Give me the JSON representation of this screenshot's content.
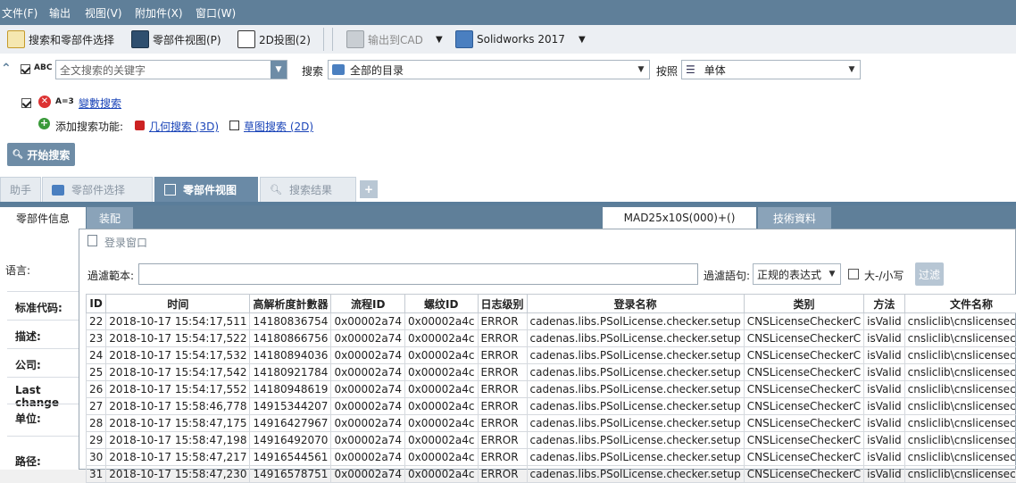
{
  "menu": [
    "文件(F)",
    "输出",
    "视图(V)",
    "附加件(X)",
    "窗口(W)"
  ],
  "toolbar": {
    "search_parts": "搜索和零部件选择",
    "part_view": "零部件视图(P)",
    "drawing_2d": "2D投图(2)",
    "export_cad": "输出到CAD",
    "cad_system": "Solidworks 2017"
  },
  "search": {
    "abc": "ABC",
    "keyword_placeholder": "全文搜索的关键字",
    "search_label": "搜索",
    "catalog": "全部的目录",
    "by_label": "按照",
    "unit": "单体"
  },
  "param": {
    "a3": "A=3",
    "param_search": "變數搜索",
    "add_label": "添加搜索功能:",
    "geo_search": "几何搜索 (3D)",
    "sketch_search": "草图搜索 (2D)",
    "start": "开始搜索"
  },
  "tabs": {
    "assist": "助手",
    "part_select": "零部件选择",
    "part_view": "零部件视图",
    "results": "搜索结果",
    "add": "+"
  },
  "subtabs": {
    "part_info": "零部件信息",
    "assembly": "装配",
    "part_name": "MAD25x10S(000)+()",
    "tech": "技術資料"
  },
  "left": {
    "language": "语言:",
    "std_code": "标准代码:",
    "desc": "描述:",
    "company": "公司:",
    "last_change": "Last change",
    "unit": "单位:",
    "path": "路径:"
  },
  "log": {
    "title": "登录窗口",
    "filter_label": "過濾範本:",
    "filter_value": "",
    "expr_label": "過濾語句:",
    "expr_value": "正规的表达式",
    "case_label": "大-/小写",
    "filter_btn": "过滤",
    "columns": [
      "ID",
      "时间",
      "高解析度計數器",
      "流程ID",
      "螺纹ID",
      "日志级别",
      "登录名称",
      "类别",
      "方法",
      "文件名称"
    ],
    "rows": [
      [
        "22",
        "2018-10-17 15:54:17,511",
        "14180836754",
        "0x00002a74",
        "0x00002a4c",
        "ERROR",
        "cadenas.libs.PSolLicense.checker.setup",
        "CNSLicenseCheckerC",
        "isValid",
        "cnsliclib\\cnslicensechec"
      ],
      [
        "23",
        "2018-10-17 15:54:17,522",
        "14180866756",
        "0x00002a74",
        "0x00002a4c",
        "ERROR",
        "cadenas.libs.PSolLicense.checker.setup",
        "CNSLicenseCheckerC",
        "isValid",
        "cnsliclib\\cnslicensechec"
      ],
      [
        "24",
        "2018-10-17 15:54:17,532",
        "14180894036",
        "0x00002a74",
        "0x00002a4c",
        "ERROR",
        "cadenas.libs.PSolLicense.checker.setup",
        "CNSLicenseCheckerC",
        "isValid",
        "cnsliclib\\cnslicensechec"
      ],
      [
        "25",
        "2018-10-17 15:54:17,542",
        "14180921784",
        "0x00002a74",
        "0x00002a4c",
        "ERROR",
        "cadenas.libs.PSolLicense.checker.setup",
        "CNSLicenseCheckerC",
        "isValid",
        "cnsliclib\\cnslicensechec"
      ],
      [
        "26",
        "2018-10-17 15:54:17,552",
        "14180948619",
        "0x00002a74",
        "0x00002a4c",
        "ERROR",
        "cadenas.libs.PSolLicense.checker.setup",
        "CNSLicenseCheckerC",
        "isValid",
        "cnsliclib\\cnslicensechec"
      ],
      [
        "27",
        "2018-10-17 15:58:46,778",
        "14915344207",
        "0x00002a74",
        "0x00002a4c",
        "ERROR",
        "cadenas.libs.PSolLicense.checker.setup",
        "CNSLicenseCheckerC",
        "isValid",
        "cnsliclib\\cnslicensechec"
      ],
      [
        "28",
        "2018-10-17 15:58:47,175",
        "14916427967",
        "0x00002a74",
        "0x00002a4c",
        "ERROR",
        "cadenas.libs.PSolLicense.checker.setup",
        "CNSLicenseCheckerC",
        "isValid",
        "cnsliclib\\cnslicensechec"
      ],
      [
        "29",
        "2018-10-17 15:58:47,198",
        "14916492070",
        "0x00002a74",
        "0x00002a4c",
        "ERROR",
        "cadenas.libs.PSolLicense.checker.setup",
        "CNSLicenseCheckerC",
        "isValid",
        "cnsliclib\\cnslicensechec"
      ],
      [
        "30",
        "2018-10-17 15:58:47,217",
        "14916544561",
        "0x00002a74",
        "0x00002a4c",
        "ERROR",
        "cadenas.libs.PSolLicense.checker.setup",
        "CNSLicenseCheckerC",
        "isValid",
        "cnsliclib\\cnslicensechec"
      ],
      [
        "31",
        "2018-10-17 15:58:47,230",
        "14916578751",
        "0x00002a74",
        "0x00002a4c",
        "ERROR",
        "cadenas.libs.PSolLicense.checker.setup",
        "CNSLicenseCheckerC",
        "isValid",
        "cnsliclib\\cnslicensechec"
      ]
    ]
  }
}
